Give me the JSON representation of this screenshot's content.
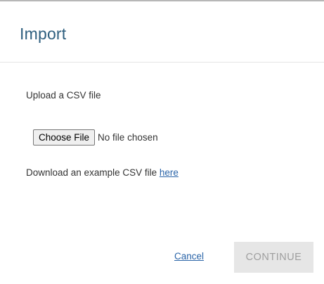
{
  "dialog": {
    "title": "Import",
    "upload_label": "Upload a CSV file",
    "file_input": {
      "button_label": "Choose File",
      "status": "No file chosen"
    },
    "download": {
      "text": "Download an example CSV file ",
      "link_label": "here"
    },
    "footer": {
      "cancel_label": "Cancel",
      "continue_label": "CONTINUE",
      "continue_enabled": false
    }
  },
  "colors": {
    "title": "#2e5f7f",
    "link": "#2a64a8",
    "disabled_button_bg": "#e6e6e6",
    "disabled_button_text": "#9e9e9e"
  }
}
